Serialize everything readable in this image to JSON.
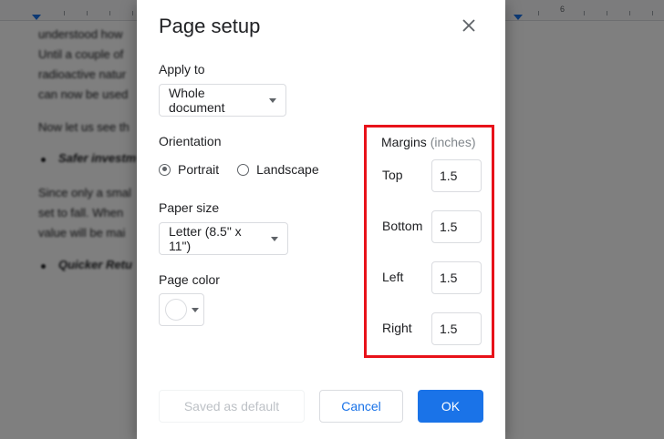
{
  "background_document": {
    "lines": [
      "understood how",
      "Until a couple of",
      "radioactive natur",
      "can now be used",
      "Now let us see th",
      "Safer investm",
      "Since only a smal",
      "set to fall. When",
      "value will be mai",
      "Quicker Retu"
    ],
    "ruler_numbers": [
      "6"
    ]
  },
  "dialog": {
    "title": "Page setup",
    "apply_to": {
      "label": "Apply to",
      "selected": "Whole document"
    },
    "orientation": {
      "label": "Orientation",
      "options": [
        {
          "label": "Portrait",
          "checked": true
        },
        {
          "label": "Landscape",
          "checked": false
        }
      ]
    },
    "paper_size": {
      "label": "Paper size",
      "selected": "Letter (8.5\" x 11\")"
    },
    "page_color": {
      "label": "Page color",
      "value": "#ffffff"
    },
    "margins": {
      "title": "Margins",
      "unit": "(inches)",
      "fields": [
        {
          "label": "Top",
          "value": "1.5"
        },
        {
          "label": "Bottom",
          "value": "1.5"
        },
        {
          "label": "Left",
          "value": "1.5"
        },
        {
          "label": "Right",
          "value": "1.5"
        }
      ],
      "highlight_color": "#e8121a"
    },
    "buttons": {
      "saved_default": "Saved as default",
      "cancel": "Cancel",
      "ok": "OK"
    }
  },
  "colors": {
    "accent": "#1a73e8",
    "scrim": "rgba(0,0,0,0.5)"
  }
}
